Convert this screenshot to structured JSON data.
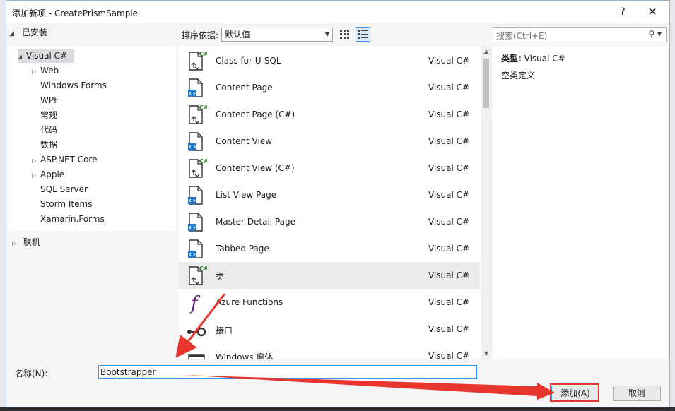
{
  "window": {
    "title": "添加新项 - CreatePrismSample",
    "help_label": "?",
    "close_label": "✕"
  },
  "tree": {
    "header": "已安装",
    "items": [
      {
        "label": "Visual C#",
        "expander": "◢",
        "level": 0
      },
      {
        "label": "Web",
        "expander": "▷",
        "level": 1
      },
      {
        "label": "Windows Forms",
        "expander": "",
        "level": 1
      },
      {
        "label": "WPF",
        "expander": "",
        "level": 1
      },
      {
        "label": "常规",
        "expander": "",
        "level": 1
      },
      {
        "label": "代码",
        "expander": "",
        "level": 1
      },
      {
        "label": "数据",
        "expander": "",
        "level": 1
      },
      {
        "label": "ASP.NET Core",
        "expander": "▷",
        "level": 1
      },
      {
        "label": "Apple",
        "expander": "▷",
        "level": 1
      },
      {
        "label": "SQL Server",
        "expander": "",
        "level": 1
      },
      {
        "label": "Storm Items",
        "expander": "",
        "level": 1
      },
      {
        "label": "Xamarin.Forms",
        "expander": "",
        "level": 1
      }
    ],
    "online": "联机"
  },
  "toolbar": {
    "sort_label": "排序依据:",
    "sort_value": "默认值"
  },
  "search": {
    "placeholder": "搜索(Ctrl+E)"
  },
  "templates": [
    {
      "name": "Class for U-SQL",
      "lang": "Visual C#",
      "icon": "csharp-file-icon"
    },
    {
      "name": "Content Page",
      "lang": "Visual C#",
      "icon": "xaml-file-icon"
    },
    {
      "name": "Content Page (C#)",
      "lang": "Visual C#",
      "icon": "csharp-file-icon"
    },
    {
      "name": "Content View",
      "lang": "Visual C#",
      "icon": "xaml-file-icon"
    },
    {
      "name": "Content View (C#)",
      "lang": "Visual C#",
      "icon": "csharp-file-icon"
    },
    {
      "name": "List View Page",
      "lang": "Visual C#",
      "icon": "xaml-file-icon"
    },
    {
      "name": "Master Detail Page",
      "lang": "Visual C#",
      "icon": "xaml-file-icon"
    },
    {
      "name": "Tabbed Page",
      "lang": "Visual C#",
      "icon": "xaml-file-icon"
    },
    {
      "name": "类",
      "lang": "Visual C#",
      "icon": "csharp-file-icon"
    },
    {
      "name": "Azure Functions",
      "lang": "Visual C#",
      "icon": "function-icon"
    },
    {
      "name": "接口",
      "lang": "Visual C#",
      "icon": "interface-icon"
    },
    {
      "name": "Windows 窗体",
      "lang": "Visual C#",
      "icon": "windows-form-icon"
    }
  ],
  "details": {
    "type_label": "类型:",
    "type_value": "Visual C#",
    "description": "空类定义"
  },
  "name_field": {
    "label": "名称(N):",
    "value": "Bootstrapper"
  },
  "buttons": {
    "add": "添加(A)",
    "cancel": "取消"
  },
  "colors": {
    "accent": "#3399ff",
    "annotation": "#e8352e",
    "csharp_badge": "#2a8a2a",
    "function_purple": "#68217a"
  }
}
